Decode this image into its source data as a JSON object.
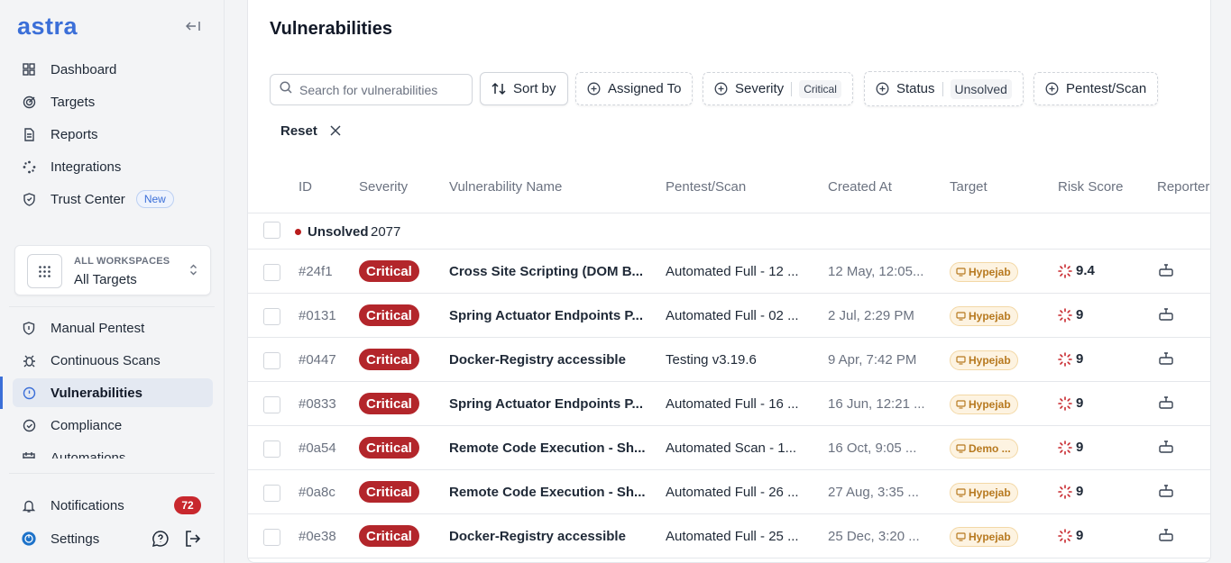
{
  "app": {
    "logo": "astra"
  },
  "sidebar": {
    "nav_top": [
      {
        "label": "Dashboard",
        "icon": "grid-icon"
      },
      {
        "label": "Targets",
        "icon": "target-icon"
      },
      {
        "label": "Reports",
        "icon": "file-icon"
      },
      {
        "label": "Integrations",
        "icon": "integrations-icon"
      },
      {
        "label": "Trust Center",
        "icon": "shield-heart-icon",
        "badge": "New"
      }
    ],
    "workspace": {
      "caption": "ALL WORKSPACES",
      "name": "All Targets"
    },
    "nav_mid": [
      {
        "label": "Manual Pentest",
        "icon": "shield-icon"
      },
      {
        "label": "Continuous Scans",
        "icon": "bug-icon"
      },
      {
        "label": "Vulnerabilities",
        "icon": "alert-circle-icon",
        "active": true
      },
      {
        "label": "Compliance",
        "icon": "check-circle-icon"
      },
      {
        "label": "Automations",
        "icon": "calendar-icon"
      }
    ],
    "notifications": {
      "label": "Notifications",
      "count": "72"
    },
    "settings": {
      "label": "Settings"
    }
  },
  "main": {
    "title": "Vulnerabilities",
    "search": {
      "placeholder": "Search for vulnerabilities"
    },
    "filters": {
      "sort_by": "Sort by",
      "assigned_to": "Assigned To",
      "severity": "Severity",
      "severity_value": "Critical",
      "status": "Status",
      "status_value": "Unsolved",
      "pentest_scan": "Pentest/Scan",
      "reset": "Reset"
    },
    "columns": [
      "ID",
      "Severity",
      "Vulnerability Name",
      "Pentest/Scan",
      "Created At",
      "Target",
      "Risk Score",
      "Reporter"
    ],
    "group": {
      "label": "Unsolved",
      "count": "2077"
    },
    "rows": [
      {
        "id": "#24f1",
        "severity": "Critical",
        "name": "Cross Site Scripting (DOM B...",
        "pentest": "Automated Full - 12 ...",
        "created": "12 May, 12:05...",
        "target": "Hypejab",
        "risk": "9.4"
      },
      {
        "id": "#0131",
        "severity": "Critical",
        "name": "Spring Actuator Endpoints P...",
        "pentest": "Automated Full - 02 ...",
        "created": "2 Jul, 2:29 PM",
        "target": "Hypejab",
        "risk": "9"
      },
      {
        "id": "#0447",
        "severity": "Critical",
        "name": "Docker-Registry accessible",
        "pentest": "Testing v3.19.6",
        "created": "9 Apr, 7:42 PM",
        "target": "Hypejab",
        "risk": "9"
      },
      {
        "id": "#0833",
        "severity": "Critical",
        "name": "Spring Actuator Endpoints P...",
        "pentest": "Automated Full - 16 ...",
        "created": "16 Jun, 12:21 ...",
        "target": "Hypejab",
        "risk": "9"
      },
      {
        "id": "#0a54",
        "severity": "Critical",
        "name": "Remote Code Execution - Sh...",
        "pentest": "Automated Scan - 1...",
        "created": "16 Oct, 9:05 ...",
        "target": "Demo ...",
        "risk": "9"
      },
      {
        "id": "#0a8c",
        "severity": "Critical",
        "name": "Remote Code Execution - Sh...",
        "pentest": "Automated Full - 26 ...",
        "created": "27 Aug, 3:35 ...",
        "target": "Hypejab",
        "risk": "9"
      },
      {
        "id": "#0e38",
        "severity": "Critical",
        "name": "Docker-Registry accessible",
        "pentest": "Automated Full - 25 ...",
        "created": "25 Dec, 3:20 ...",
        "target": "Hypejab",
        "risk": "9"
      }
    ]
  },
  "colors": {
    "accent": "#3b6fd8",
    "critical": "#b3262b",
    "target_bg": "#fdf3e1",
    "target_text": "#b7791f",
    "notif": "#c8282e"
  }
}
